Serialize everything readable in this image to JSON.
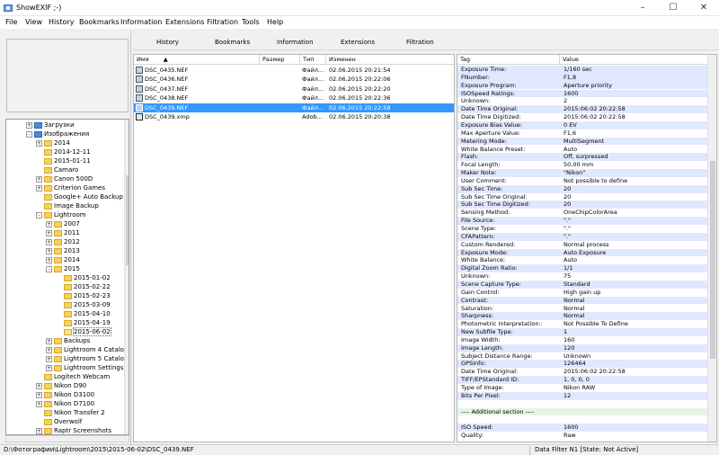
{
  "window": {
    "title": "ShowEXIF ;-)"
  },
  "menu": [
    "File",
    "View",
    "History",
    "Bookmarks",
    "Information",
    "Extensions",
    "Filtration",
    "Tools",
    "Help"
  ],
  "tabs": [
    "History",
    "Bookmarks",
    "Information",
    "Extensions",
    "Filtration"
  ],
  "tree": [
    {
      "label": "Загрузки",
      "depth": 1,
      "pm": "+",
      "icon": "special"
    },
    {
      "label": "Изображения",
      "depth": 1,
      "pm": "-",
      "icon": "special"
    },
    {
      "label": "2014",
      "depth": 2,
      "pm": "+",
      "icon": "folder"
    },
    {
      "label": "2014-12-11",
      "depth": 2,
      "pm": "",
      "icon": "folder"
    },
    {
      "label": "2015-01-11",
      "depth": 2,
      "pm": "",
      "icon": "folder"
    },
    {
      "label": "Camaro",
      "depth": 2,
      "pm": "",
      "icon": "folder"
    },
    {
      "label": "Canon 500D",
      "depth": 2,
      "pm": "+",
      "icon": "folder"
    },
    {
      "label": "Criterion Games",
      "depth": 2,
      "pm": "+",
      "icon": "folder"
    },
    {
      "label": "Google+ Auto Backup",
      "depth": 2,
      "pm": "",
      "icon": "folder"
    },
    {
      "label": "Image Backup",
      "depth": 2,
      "pm": "",
      "icon": "folder"
    },
    {
      "label": "Lightroom",
      "depth": 2,
      "pm": "-",
      "icon": "folder"
    },
    {
      "label": "2007",
      "depth": 3,
      "pm": "+",
      "icon": "folder"
    },
    {
      "label": "2011",
      "depth": 3,
      "pm": "+",
      "icon": "folder"
    },
    {
      "label": "2012",
      "depth": 3,
      "pm": "+",
      "icon": "folder"
    },
    {
      "label": "2013",
      "depth": 3,
      "pm": "+",
      "icon": "folder"
    },
    {
      "label": "2014",
      "depth": 3,
      "pm": "+",
      "icon": "folder"
    },
    {
      "label": "2015",
      "depth": 3,
      "pm": "-",
      "icon": "folder"
    },
    {
      "label": "2015-01-02",
      "depth": 4,
      "pm": "",
      "icon": "folder"
    },
    {
      "label": "2015-02-22",
      "depth": 4,
      "pm": "",
      "icon": "folder"
    },
    {
      "label": "2015-02-23",
      "depth": 4,
      "pm": "",
      "icon": "folder"
    },
    {
      "label": "2015-03-09",
      "depth": 4,
      "pm": "",
      "icon": "folder"
    },
    {
      "label": "2015-04-10",
      "depth": 4,
      "pm": "",
      "icon": "folder"
    },
    {
      "label": "2015-04-19",
      "depth": 4,
      "pm": "",
      "icon": "folder"
    },
    {
      "label": "2015-06-02",
      "depth": 4,
      "pm": "",
      "icon": "open",
      "selected": true
    },
    {
      "label": "Backups",
      "depth": 3,
      "pm": "+",
      "icon": "folder"
    },
    {
      "label": "Lightroom 4 Catalo",
      "depth": 3,
      "pm": "+",
      "icon": "folder"
    },
    {
      "label": "Lightroom 5 Catalo",
      "depth": 3,
      "pm": "+",
      "icon": "folder"
    },
    {
      "label": "Lightroom Settings",
      "depth": 3,
      "pm": "+",
      "icon": "folder"
    },
    {
      "label": "Logitech Webcam",
      "depth": 2,
      "pm": "",
      "icon": "folder"
    },
    {
      "label": "Nikon D90",
      "depth": 2,
      "pm": "+",
      "icon": "folder"
    },
    {
      "label": "Nikon D3100",
      "depth": 2,
      "pm": "+",
      "icon": "folder"
    },
    {
      "label": "Nikon D7100",
      "depth": 2,
      "pm": "+",
      "icon": "folder"
    },
    {
      "label": "Nikon Transfer 2",
      "depth": 2,
      "pm": "",
      "icon": "folder"
    },
    {
      "label": "Overwolf",
      "depth": 2,
      "pm": "",
      "icon": "folder"
    },
    {
      "label": "Raptr Screenshots",
      "depth": 2,
      "pm": "+",
      "icon": "folder"
    }
  ],
  "filelist": {
    "columns": [
      "Имя",
      "Размер",
      "Тип",
      "Изменен"
    ],
    "sort_indicator": "▲",
    "rows": [
      {
        "name": "DSC_0435.NEF",
        "size": "",
        "type": "Файл...",
        "modified": "02.06.2015 20:21:54",
        "kind": "nef"
      },
      {
        "name": "DSC_0436.NEF",
        "size": "",
        "type": "Файл...",
        "modified": "02.06.2015 20:22:06",
        "kind": "nef"
      },
      {
        "name": "DSC_0437.NEF",
        "size": "",
        "type": "Файл...",
        "modified": "02.06.2015 20:22:20",
        "kind": "nef"
      },
      {
        "name": "DSC_0438.NEF",
        "size": "",
        "type": "Файл...",
        "modified": "02.06.2015 20:22:36",
        "kind": "nef"
      },
      {
        "name": "DSC_0439.NEF",
        "size": "",
        "type": "Файл...",
        "modified": "02.06.2015 20:22:58",
        "kind": "nef",
        "selected": true
      },
      {
        "name": "DSC_0439.xmp",
        "size": "",
        "type": "Adob...",
        "modified": "02.06.2015 20:20:38",
        "kind": "xmp"
      }
    ]
  },
  "exif": {
    "columns": [
      "Tag",
      "Value"
    ],
    "rows": [
      {
        "tag": "Exposure Time:",
        "value": "1/160 sec",
        "hl": "blue"
      },
      {
        "tag": "FNumber:",
        "value": "F1,8",
        "hl": "blue"
      },
      {
        "tag": "Exposure Program:",
        "value": "Aperture priority",
        "hl": "blue"
      },
      {
        "tag": "ISOSpeed Ratings:",
        "value": "1600",
        "hl": "blue"
      },
      {
        "tag": "Unknown:",
        "value": "2",
        "hl": ""
      },
      {
        "tag": "Date Time Original:",
        "value": "2015:06:02 20:22:58",
        "hl": "blue"
      },
      {
        "tag": "Date Time Digitized:",
        "value": "2015:06:02 20:22:58",
        "hl": ""
      },
      {
        "tag": "Exposure Bias Value:",
        "value": "0 EV",
        "hl": "blue"
      },
      {
        "tag": "Max Aperture Value:",
        "value": "F1,6",
        "hl": ""
      },
      {
        "tag": "Metering Mode:",
        "value": "MultiSegment",
        "hl": "blue"
      },
      {
        "tag": "White Balance Preset:",
        "value": "Auto",
        "hl": ""
      },
      {
        "tag": "Flash:",
        "value": "Off, surpressed",
        "hl": "blue"
      },
      {
        "tag": "Focal Length:",
        "value": "50,00 mm",
        "hl": ""
      },
      {
        "tag": "Maker Note:",
        "value": "\"Nikon\"",
        "hl": "blue"
      },
      {
        "tag": "User Comment:",
        "value": "Not possible to define",
        "hl": ""
      },
      {
        "tag": "Sub Sec Time:",
        "value": "20",
        "hl": "blue"
      },
      {
        "tag": "Sub Sec Time Original:",
        "value": "20",
        "hl": ""
      },
      {
        "tag": "Sub Sec Time Digitized:",
        "value": "20",
        "hl": "blue"
      },
      {
        "tag": "Sensing Method:",
        "value": "OneChipColorArea",
        "hl": ""
      },
      {
        "tag": "File Source:",
        "value": "\".\"",
        "hl": "blue"
      },
      {
        "tag": "Scene Type:",
        "value": "\".\"",
        "hl": ""
      },
      {
        "tag": "CFAPattern:",
        "value": "\".\"",
        "hl": "blue"
      },
      {
        "tag": "Custom Rendered:",
        "value": "Normal process",
        "hl": ""
      },
      {
        "tag": "Exposure Mode:",
        "value": "Auto Exposure",
        "hl": "blue"
      },
      {
        "tag": "White Balance:",
        "value": "Auto",
        "hl": ""
      },
      {
        "tag": "Digital Zoom Ratio:",
        "value": "1/1",
        "hl": "blue"
      },
      {
        "tag": "Unknown:",
        "value": "75",
        "hl": ""
      },
      {
        "tag": "Scene Capture Type:",
        "value": "Standard",
        "hl": "blue"
      },
      {
        "tag": "Gain Control:",
        "value": "High gain up",
        "hl": ""
      },
      {
        "tag": "Contrast:",
        "value": "Normal",
        "hl": "blue"
      },
      {
        "tag": "Saturation:",
        "value": "Normal",
        "hl": ""
      },
      {
        "tag": "Sharpness:",
        "value": "Normal",
        "hl": "blue"
      },
      {
        "tag": "Photometric Interpretation::",
        "value": "Not Possible To Define",
        "hl": ""
      },
      {
        "tag": "New Subfile Type:",
        "value": "1",
        "hl": "blue"
      },
      {
        "tag": "Image Width:",
        "value": "160",
        "hl": ""
      },
      {
        "tag": "Image Length:",
        "value": "120",
        "hl": "blue"
      },
      {
        "tag": "Subject Distance Range:",
        "value": "Unknown",
        "hl": ""
      },
      {
        "tag": "GPSInfo:",
        "value": "126464",
        "hl": "blue"
      },
      {
        "tag": "Date Time Original:",
        "value": "2015:06:02 20:22:58",
        "hl": ""
      },
      {
        "tag": "TIFF/EPStandard ID:",
        "value": "1, 0, 0, 0",
        "hl": "blue"
      },
      {
        "tag": "Type of Image:",
        "value": "Nikon RAW",
        "hl": ""
      },
      {
        "tag": "Bits Per Pixel:",
        "value": "12",
        "hl": "blue"
      },
      {
        "tag": "",
        "value": "",
        "hl": ""
      },
      {
        "tag": "---- Additional section ----",
        "value": "",
        "hl": "green"
      },
      {
        "tag": "",
        "value": "",
        "hl": ""
      },
      {
        "tag": "ISO Speed:",
        "value": "1600",
        "hl": "blue"
      },
      {
        "tag": "Quality:",
        "value": "Raw",
        "hl": ""
      }
    ]
  },
  "status": {
    "path": "D:\\Фотографии\\Lightroom\\2015\\2015-06-02\\DSC_0439.NEF",
    "filter": "Data Filter N1 [State: Not Active]"
  },
  "colors": {
    "selection": "#3399ff",
    "row_blue": "#dfe8ff",
    "row_green": "#e4f5e4"
  }
}
